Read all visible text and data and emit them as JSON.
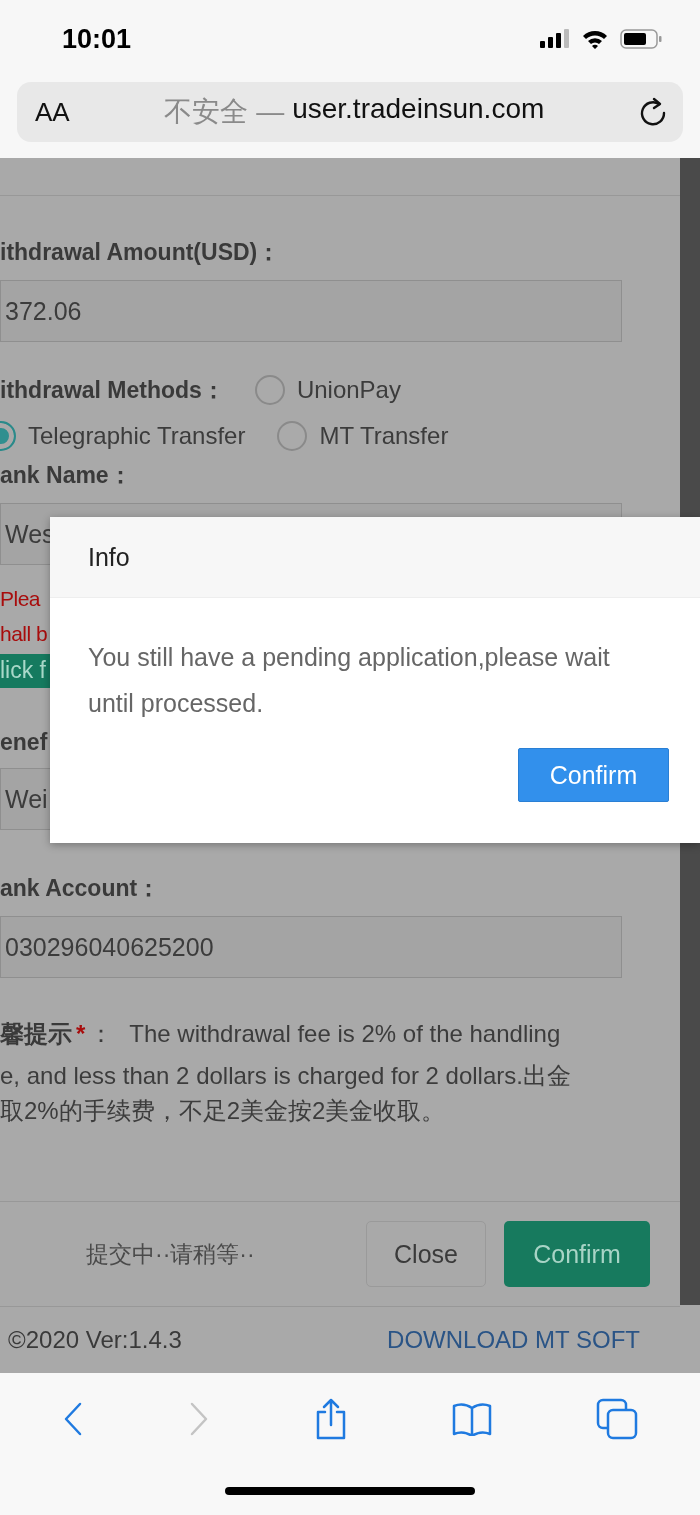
{
  "status_bar": {
    "time": "10:01"
  },
  "browser": {
    "text_size": "AA",
    "security": "不安全 —",
    "url": "user.tradeinsun.com"
  },
  "form": {
    "amount_label": "ithdrawal Amount(USD)：",
    "amount_value": "372.06",
    "methods_label": "ithdrawal Methods：",
    "methods": [
      {
        "label": "UnionPay",
        "selected": false
      },
      {
        "label": "Telegraphic Transfer",
        "selected": true
      },
      {
        "label": "MT Transfer",
        "selected": false
      }
    ],
    "bank_name_label": "ank Name：",
    "bank_name_value": "Wes",
    "warning_lines": [
      "Plea",
      "hall b"
    ],
    "link_button": "lick f",
    "beneficiary_label": "enef",
    "beneficiary_value": "Wei",
    "bank_account_label": "ank Account：",
    "bank_account_value": "030296040625200",
    "note_label": "馨提示",
    "note_required": "*",
    "note_colon": "：",
    "note_lines": [
      "The withdrawal fee is 2% of the handling",
      "e, and less than 2 dollars is charged for 2 dollars.出金",
      "取2%的手续费，不足2美金按2美金收取。"
    ]
  },
  "footer_bar": {
    "status": "提交中··请稍等··",
    "close": "Close",
    "confirm": "Confirm"
  },
  "page_footer": {
    "copyright": "©2020 Ver:1.4.3",
    "download": "DOWNLOAD MT SOFT"
  },
  "dialog": {
    "title": "Info",
    "message": "You still have a pending application,please wait until processed.",
    "confirm": "Confirm"
  }
}
